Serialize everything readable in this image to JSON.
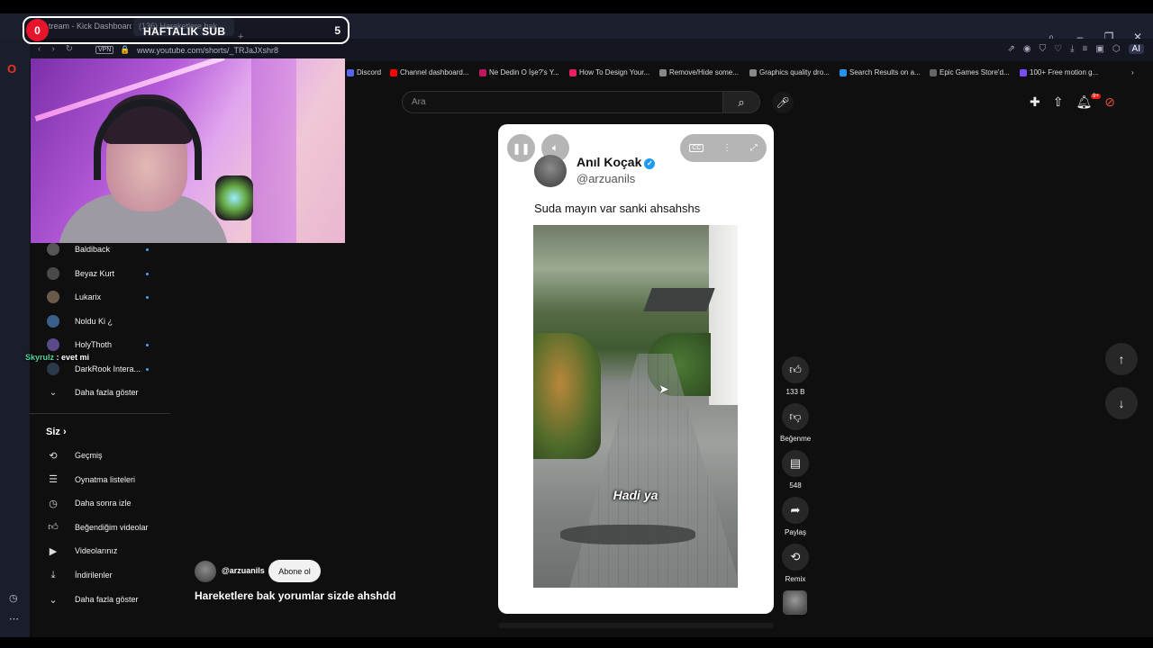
{
  "browser": {
    "tabs": [
      "tream - Kick Dashboard",
      "(136) Hareketlere bak..."
    ],
    "url": "www.youtube.com/shorts/_TRJaJXshr8",
    "vpn_label": "VPN",
    "ai_label": "AI",
    "bookmarks": [
      {
        "label": "Discord",
        "color": "#5865f2"
      },
      {
        "label": "Channel dashboard...",
        "color": "#ff0000"
      },
      {
        "label": "Ne Dedin O İşe?'s Y...",
        "color": "#c2185b"
      },
      {
        "label": "How To Design Your...",
        "color": "#e91e63"
      },
      {
        "label": "Remove/Hide some...",
        "color": "#888888"
      },
      {
        "label": "Graphics quality dro...",
        "color": "#888888"
      },
      {
        "label": "Search Results on a...",
        "color": "#2196f3"
      },
      {
        "label": "Epic Games Store'd...",
        "color": "#666666"
      },
      {
        "label": "100+ Free motion g...",
        "color": "#7c4dff"
      }
    ]
  },
  "stream_overlay": {
    "sub_count": "0",
    "title": "HAFTALIK SUB",
    "goal": "5",
    "chat": {
      "user": "Skyrulz",
      "message": " : evet mi"
    }
  },
  "youtube": {
    "search_placeholder": "Ara",
    "notification_badge": "9+",
    "subscriptions": [
      {
        "name": "Baldiback",
        "live": true,
        "color": "#555555"
      },
      {
        "name": "Beyaz Kurt",
        "live": true,
        "color": "#4a4a4a"
      },
      {
        "name": "Lukarix",
        "live": true,
        "color": "#6b5a4a"
      },
      {
        "name": "Noldu Ki ¿",
        "live": false,
        "color": "#3a5f8a"
      },
      {
        "name": "HolyThoth",
        "live": true,
        "color": "#5a4a8a"
      },
      {
        "name": "DarkRook Intera...",
        "live": true,
        "color": "#2a3a4a"
      }
    ],
    "show_more": "Daha fazla göster",
    "you_section": "Siz",
    "you_items": [
      {
        "label": "Geçmiş",
        "icon": "history-icon"
      },
      {
        "label": "Oynatma listeleri",
        "icon": "playlist-icon"
      },
      {
        "label": "Daha sonra izle",
        "icon": "clock-icon"
      },
      {
        "label": "Beğendiğim videolar",
        "icon": "thumbs-up-icon"
      },
      {
        "label": "Videolarınız",
        "icon": "video-icon"
      },
      {
        "label": "İndirilenler",
        "icon": "download-icon"
      }
    ],
    "show_more_2": "Daha fazla göster",
    "short": {
      "post_author": "Anıl Koçak",
      "post_handle": "@arzuanils",
      "post_text": "Suda mayın var sanki ahsahshs",
      "photo_caption": "Hadi ya",
      "channel_handle": "@arzuanils",
      "subscribe_label": "Abone ol",
      "title": "Hareketlere bak yorumlar sizde ahshdd"
    },
    "actions": {
      "likes": "133 B",
      "dislike_label": "Beğenme",
      "comments": "548",
      "share_label": "Paylaş",
      "remix_label": "Remix"
    }
  }
}
